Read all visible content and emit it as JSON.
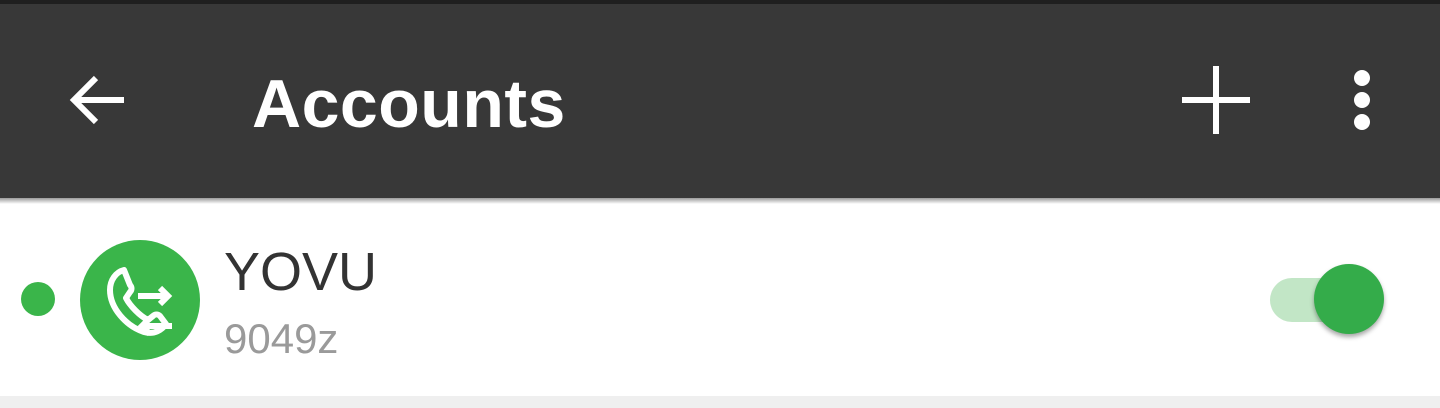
{
  "appbar": {
    "title": "Accounts",
    "back_icon": "arrow-back-icon",
    "add_icon": "plus-icon",
    "more_icon": "more-vert-icon",
    "background": "#383838"
  },
  "accounts": [
    {
      "name": "YOVU",
      "username": "9049z",
      "status": "online",
      "status_color": "#3ab54a",
      "avatar_icon": "phone-transfer-icon",
      "avatar_color": "#3ab54a",
      "enabled": true
    }
  ],
  "colors": {
    "accent": "#34ac4a",
    "accent_light": "#c2e6c6"
  }
}
